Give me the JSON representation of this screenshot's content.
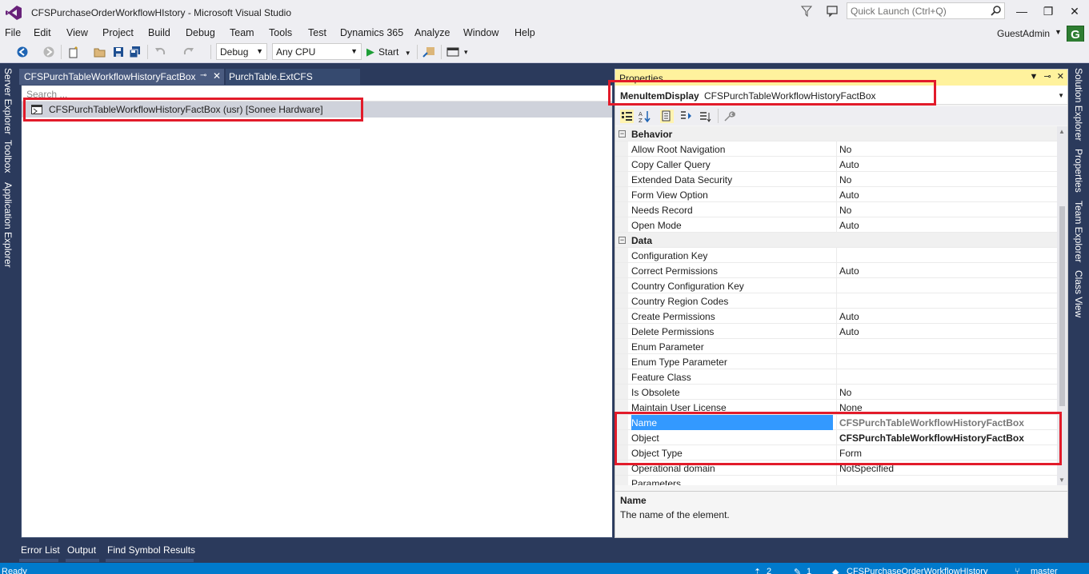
{
  "window": {
    "title": "CFSPurchaseOrderWorkflowHIstory - Microsoft Visual Studio",
    "quick_launch_placeholder": "Quick Launch (Ctrl+Q)",
    "account_name": "GuestAdmin",
    "avatar_letter": "G",
    "min_glyph": "—",
    "max_glyph": "❐",
    "close_glyph": "✕"
  },
  "menu": {
    "items": [
      "File",
      "Edit",
      "View",
      "Project",
      "Build",
      "Debug",
      "Team",
      "Tools",
      "Test",
      "Dynamics 365",
      "Analyze",
      "Window",
      "Help"
    ]
  },
  "toolbar": {
    "configuration": "Debug",
    "platform": "Any CPU",
    "start_label": "Start"
  },
  "left_tool_tabs": [
    "Server Explorer",
    "Toolbox",
    "Application Explorer"
  ],
  "right_tool_tabs": [
    "Solution Explorer",
    "Properties",
    "Team Explorer",
    "Class View"
  ],
  "document_tabs": {
    "active": "CFSPurchTableWorkflowHistoryFactBox",
    "second": "PurchTable.ExtCFS"
  },
  "editor": {
    "search_placeholder": "Search ...",
    "tree_root": "CFSPurchTableWorkflowHistoryFactBox (usr) [Sonee Hardware]"
  },
  "properties": {
    "title": "Properties",
    "object_type": "MenuItemDisplay",
    "object_name": "CFSPurchTableWorkflowHistoryFactBox",
    "rows": [
      {
        "kind": "cat",
        "name": "Behavior",
        "value": ""
      },
      {
        "kind": "prop",
        "name": "Allow Root Navigation",
        "value": "No"
      },
      {
        "kind": "prop",
        "name": "Copy Caller Query",
        "value": "Auto"
      },
      {
        "kind": "prop",
        "name": "Extended Data Security",
        "value": "No"
      },
      {
        "kind": "prop",
        "name": "Form View Option",
        "value": "Auto"
      },
      {
        "kind": "prop",
        "name": "Needs Record",
        "value": "No"
      },
      {
        "kind": "prop",
        "name": "Open Mode",
        "value": "Auto"
      },
      {
        "kind": "cat",
        "name": "Data",
        "value": ""
      },
      {
        "kind": "prop",
        "name": "Configuration Key",
        "value": ""
      },
      {
        "kind": "prop",
        "name": "Correct Permissions",
        "value": "Auto"
      },
      {
        "kind": "prop",
        "name": "Country Configuration Key",
        "value": ""
      },
      {
        "kind": "prop",
        "name": "Country Region Codes",
        "value": ""
      },
      {
        "kind": "prop",
        "name": "Create Permissions",
        "value": "Auto"
      },
      {
        "kind": "prop",
        "name": "Delete Permissions",
        "value": "Auto"
      },
      {
        "kind": "prop",
        "name": "Enum Parameter",
        "value": ""
      },
      {
        "kind": "prop",
        "name": "Enum Type Parameter",
        "value": ""
      },
      {
        "kind": "prop",
        "name": "Feature Class",
        "value": ""
      },
      {
        "kind": "prop",
        "name": "Is Obsolete",
        "value": "No"
      },
      {
        "kind": "prop",
        "name": "Maintain User License",
        "value": "None"
      },
      {
        "kind": "sel",
        "name": "Name",
        "value": "CFSPurchTableWorkflowHistoryFactBox"
      },
      {
        "kind": "bold",
        "name": "Object",
        "value": "CFSPurchTableWorkflowHistoryFactBox"
      },
      {
        "kind": "prop",
        "name": "Object Type",
        "value": "Form"
      },
      {
        "kind": "prop",
        "name": "Operational domain",
        "value": "NotSpecified"
      },
      {
        "kind": "prop",
        "name": "Parameters",
        "value": ""
      }
    ],
    "description_title": "Name",
    "description_text": "The name of the element."
  },
  "bottom_tabs": [
    "Error List",
    "Output",
    "Find Symbol Results"
  ],
  "status": {
    "left": "Ready",
    "pending": "2",
    "edits": "1",
    "project": "CFSPurchaseOrderWorkflowHIstory",
    "branch": "master"
  }
}
